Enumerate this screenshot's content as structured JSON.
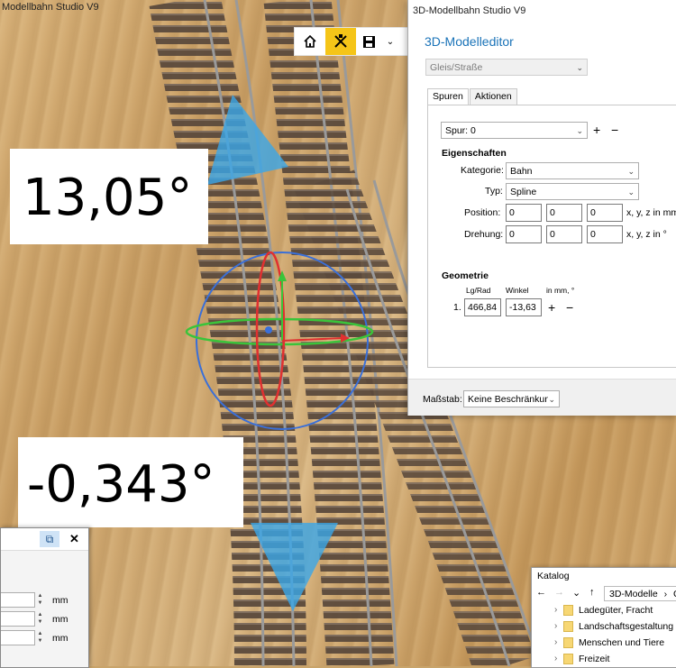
{
  "window": {
    "title_left": "Modellbahn Studio V9"
  },
  "labels": {
    "angle_top": "13,05°",
    "angle_bottom": "-0,343°"
  },
  "toolbar": {
    "home_icon": "home-icon",
    "tools_icon": "tools-icon",
    "save_icon": "save-icon",
    "dropdown_icon": "chevron-down-icon",
    "accent": "#f5c518"
  },
  "editor": {
    "window_title": "3D-Modellbahn Studio V9",
    "heading": "3D-Modelleditor",
    "type_combo": "Gleis/Straße",
    "tabs": [
      "Spuren",
      "Aktionen"
    ],
    "spur": "Spur: 0",
    "eigenschaften": "Eigenschaften",
    "kategorie_label": "Kategorie:",
    "kategorie_value": "Bahn",
    "typ_label": "Typ:",
    "typ_value": "Spline",
    "position_label": "Position:",
    "position_values": [
      "0",
      "0",
      "0"
    ],
    "position_unit": "x, y, z in mm",
    "drehung_label": "Drehung:",
    "drehung_values": [
      "0",
      "0",
      "0"
    ],
    "drehung_unit": "x, y, z in °",
    "geometrie": "Geometrie",
    "col_lgrad": "Lg/Rad",
    "col_winkel": "Winkel",
    "col_unit": "in mm, °",
    "row_index": "1.",
    "row_lgrad": "466,84",
    "row_winkel": "-13,63",
    "plus": "+",
    "minus": "−",
    "massstab_label": "Maßstab:",
    "massstab_value": "Keine Beschränkung",
    "heading_color": "#1a73b8"
  },
  "left_dialog": {
    "units": [
      "mm",
      "mm",
      "mm"
    ],
    "close": "✕"
  },
  "catalog": {
    "title": "Katalog",
    "path": "3D-Modelle",
    "path_more": "C",
    "items": [
      "Ladegüter, Fracht",
      "Landschaftsgestaltung",
      "Menschen und Tiere",
      "Freizeit"
    ]
  }
}
